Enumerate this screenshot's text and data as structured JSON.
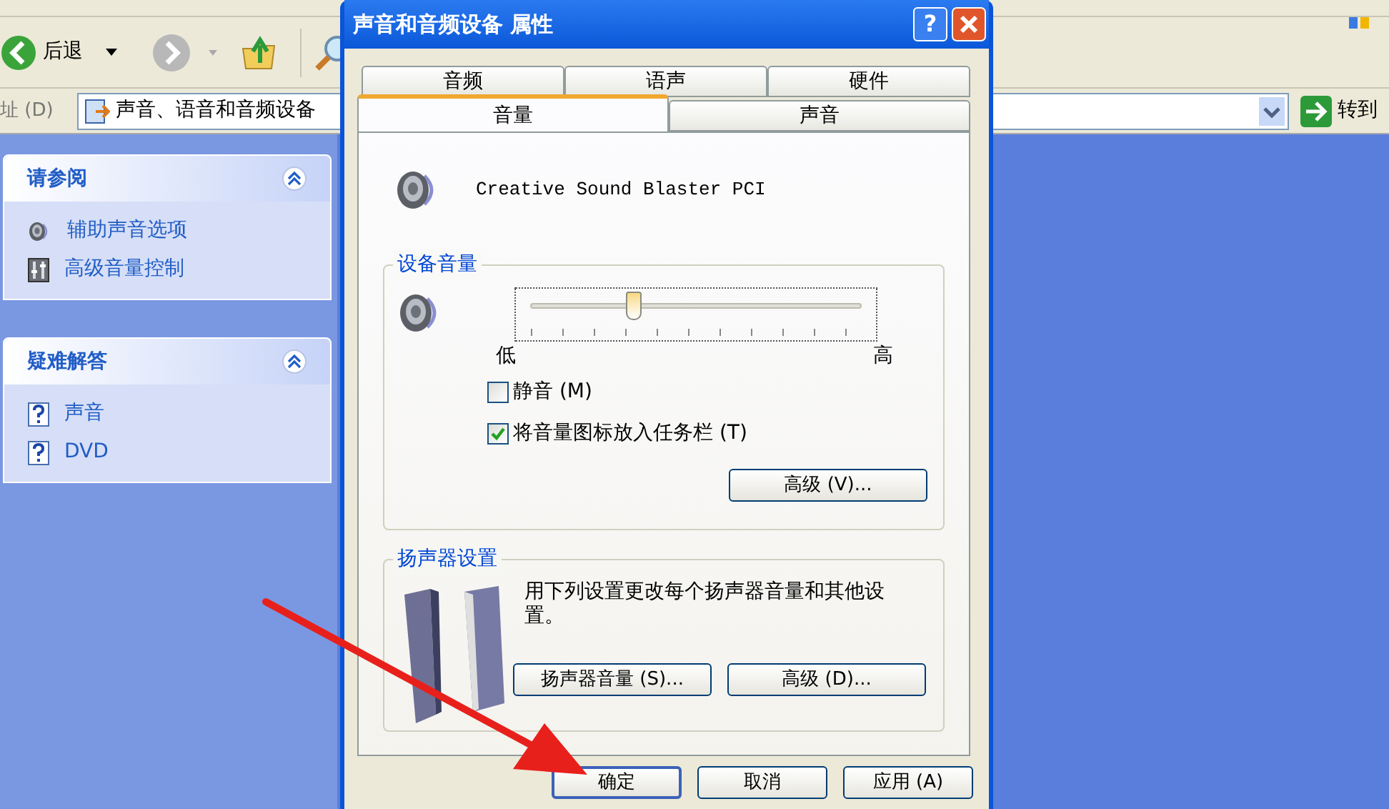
{
  "explorer": {
    "toolbar": {
      "back_label": "后退"
    },
    "address": {
      "label": "址 (D)",
      "value": "声音、语音和音频设备",
      "go_label": "转到"
    },
    "sidebar": [
      {
        "title": "请参阅",
        "expanded": true,
        "items": [
          {
            "label": "辅助声音选项",
            "kind": "speaker"
          },
          {
            "label": "高级音量控制",
            "kind": "mixer"
          }
        ]
      },
      {
        "title": "疑难解答",
        "expanded": true,
        "items": [
          {
            "label": "声音",
            "kind": "help"
          },
          {
            "label": "DVD",
            "kind": "help"
          }
        ]
      }
    ]
  },
  "dialog": {
    "title": "声音和音频设备 属性",
    "help_button": "?",
    "tab_rows": [
      [
        {
          "label": "音频",
          "selected": false
        },
        {
          "label": "语声",
          "selected": false
        },
        {
          "label": "硬件",
          "selected": false
        }
      ],
      [
        {
          "label": "音量",
          "selected": true
        },
        {
          "label": "声音",
          "selected": false
        }
      ]
    ],
    "device": "Creative Sound Blaster PCI",
    "volume_group": {
      "title": "设备音量",
      "level": 0.31,
      "low": "低",
      "high": "高",
      "checkboxes": [
        {
          "label": "静音 (M)",
          "checked": false
        },
        {
          "label": "将音量图标放入任务栏 (T)",
          "checked": true
        }
      ],
      "button": "高级 (V)..."
    },
    "speaker_group": {
      "title": "扬声器设置",
      "text": "用下列设置更改每个扬声器音量和其他设置。",
      "buttons": [
        "扬声器音量 (S)...",
        "高级 (D)..."
      ]
    },
    "buttons": [
      {
        "label": "确定",
        "default": true
      },
      {
        "label": "取消",
        "default": false
      },
      {
        "label": "应用 (A)",
        "default": false
      }
    ]
  }
}
